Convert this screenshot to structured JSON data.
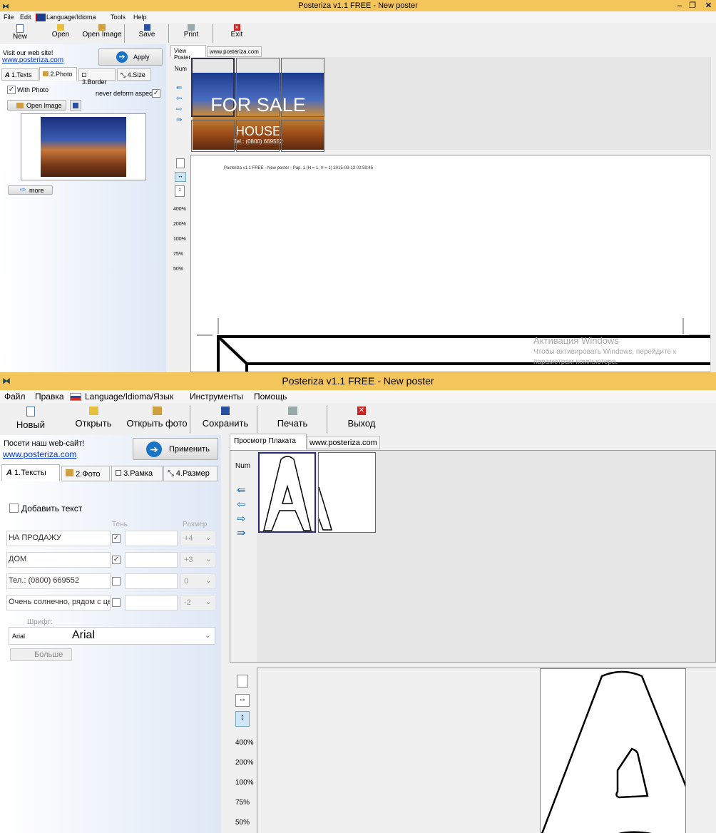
{
  "top": {
    "title": "Posteriza v1.1 FREE - New poster",
    "menu": [
      "File",
      "Edit",
      "Language/Idioma",
      "Tools",
      "Help"
    ],
    "toolbar": [
      "New",
      "Open",
      "Open Image",
      "Save",
      "Print",
      "Exit"
    ],
    "visit": "Visit our web site!",
    "site": "www.posteriza.com",
    "apply": "Apply",
    "tabs": [
      "1.Texts",
      "2.Photo",
      "3.Border",
      "4.Size"
    ],
    "with_photo": "With Photo",
    "never_deform": "never deform aspect",
    "open_image": "Open Image",
    "more": "more",
    "view_tabs": [
      "View Poster",
      "www.posteriza.com"
    ],
    "num": "Num",
    "thumb_text1": "FOR SALE",
    "thumb_text2": "HOUSE",
    "thumb_text3": "Tel.: (0800) 669552",
    "zoom": [
      "400%",
      "200%",
      "100%",
      "75%",
      "50%"
    ],
    "page_header": "Posteriza v1.1 FREE - New poster - Pap. 1 (H = 1, V = 1) 2015-09-13  02:59:45",
    "watermark1": "Активация Windows",
    "watermark2": "Чтобы активировать Windows, перейдите к",
    "watermark3": "параметрам компьютера."
  },
  "bottom": {
    "title": "Posteriza v1.1 FREE - New poster",
    "menu": [
      "Файл",
      "Правка",
      "Language/Idioma/Язык",
      "Инструменты",
      "Помощь"
    ],
    "toolbar": [
      "Новый",
      "Открыть",
      "Открыть фото",
      "Сохранить",
      "Печать",
      "Выход"
    ],
    "visit": "Посети наш web-сайт!",
    "site": "www.posteriza.com",
    "apply": "Применить",
    "tabs": [
      "1.Тексты",
      "2.Фото",
      "3.Рамка",
      "4.Размер"
    ],
    "add_text": "Добавить текст",
    "shadow_label": "Тень",
    "size_label": "Размер",
    "rows": [
      {
        "text": "НА ПРОДАЖУ",
        "shadow": true,
        "size": "+4"
      },
      {
        "text": "ДОМ",
        "shadow": true,
        "size": "+3"
      },
      {
        "text": "Тел.: (0800) 669552",
        "shadow": false,
        "size": "0"
      },
      {
        "text": "Очень солнечно, рядом с це",
        "shadow": false,
        "size": "-2"
      }
    ],
    "font_label": "Шрифт:",
    "font_small": "Arial",
    "font_big": "Arial",
    "more": "Больше",
    "view_tabs": [
      "Просмотр Плаката",
      "www.posteriza.com"
    ],
    "num": "Num",
    "zoom": [
      "400%",
      "200%",
      "100%",
      "75%",
      "50%"
    ]
  },
  "colors": {
    "titlebar": "#f3c55a",
    "link": "#0033cc",
    "apply_icon": "#1a73c6",
    "exit_icon": "#cc2222"
  }
}
